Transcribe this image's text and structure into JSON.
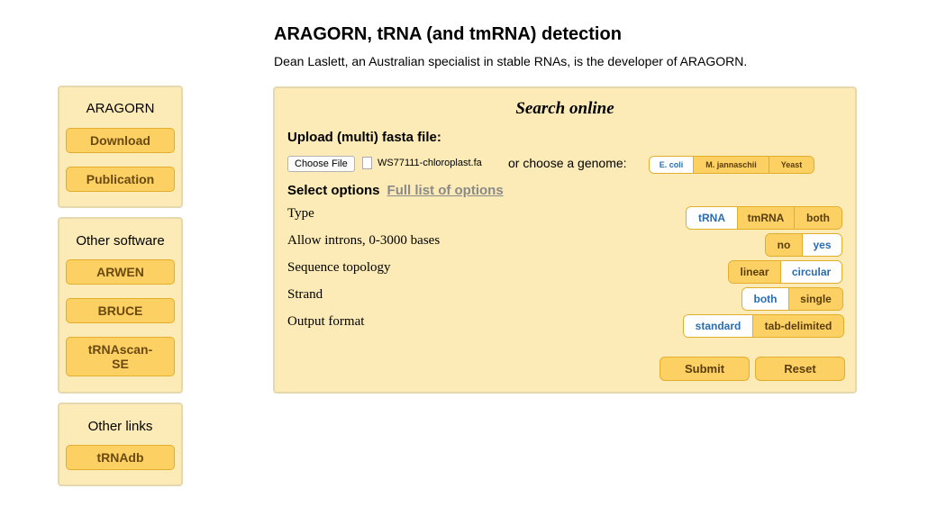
{
  "header": {
    "title": "ARAGORN, tRNA (and tmRNA) detection",
    "subtitle": "Dean Laslett, an Australian specialist in stable RNAs, is the developer of ARAGORN."
  },
  "sidebar": {
    "aragorn": {
      "title": "ARAGORN",
      "buttons": [
        "Download",
        "Publication"
      ]
    },
    "other_software": {
      "title": "Other software",
      "buttons": [
        "ARWEN",
        "BRUCE",
        "tRNAscan-SE"
      ]
    },
    "other_links": {
      "title": "Other links",
      "buttons": [
        "tRNAdb"
      ]
    }
  },
  "search": {
    "title": "Search online",
    "upload_label": "Upload (multi) fasta file:",
    "choose_file_label": "Choose File",
    "file_name": "WS77111-chloroplast.fa",
    "genome_label": "or choose a genome:",
    "genomes": [
      "E. coli",
      "M. jannaschii",
      "Yeast"
    ],
    "genome_selected": "E. coli",
    "select_options_label": "Select options",
    "full_list_link": "Full list of options",
    "options": [
      {
        "label": "Type",
        "choices": [
          "tRNA",
          "tmRNA",
          "both"
        ],
        "selected": "tRNA"
      },
      {
        "label": "Allow introns, 0-3000 bases",
        "choices": [
          "no",
          "yes"
        ],
        "selected": "yes"
      },
      {
        "label": "Sequence topology",
        "choices": [
          "linear",
          "circular"
        ],
        "selected": "circular"
      },
      {
        "label": "Strand",
        "choices": [
          "both",
          "single"
        ],
        "selected": "both"
      },
      {
        "label": "Output format",
        "choices": [
          "standard",
          "tab-delimited"
        ],
        "selected": "standard"
      }
    ],
    "submit_label": "Submit",
    "reset_label": "Reset"
  },
  "colors": {
    "panel_bg": "#fcebb6",
    "button_bg": "#fcd063",
    "selected_text": "#2a6db0"
  }
}
